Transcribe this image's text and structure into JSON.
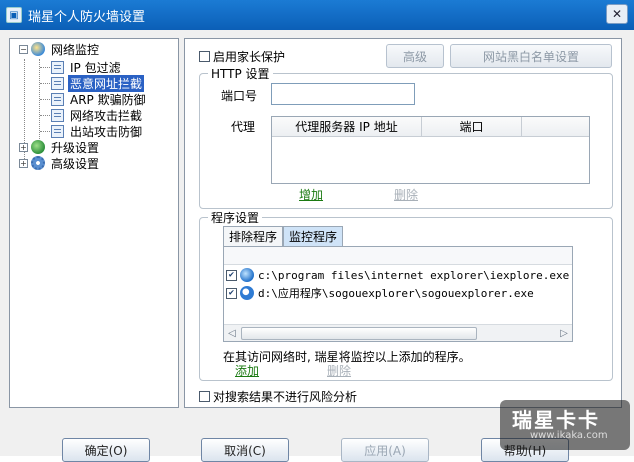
{
  "window": {
    "title": "瑞星个人防火墙设置",
    "close_glyph": "✕"
  },
  "tree": {
    "root": {
      "label": "网络监控",
      "expander": "−",
      "icon": "globe-shield-icon"
    },
    "children": [
      {
        "label": "IP 包过滤",
        "icon": "document-icon"
      },
      {
        "label": "恶意网址拦截",
        "icon": "document-icon",
        "selected": true
      },
      {
        "label": "ARP 欺骗防御",
        "icon": "document-icon"
      },
      {
        "label": "网络攻击拦截",
        "icon": "document-icon"
      },
      {
        "label": "出站攻击防御",
        "icon": "document-icon"
      }
    ],
    "others": [
      {
        "label": "升级设置",
        "expander": "+",
        "icon": "globe-icon"
      },
      {
        "label": "高级设置",
        "expander": "+",
        "icon": "gear-icon"
      }
    ]
  },
  "panel": {
    "parental_label": "启用家长保护",
    "advanced_button": "高级",
    "blacklist_button": "网站黑白名单设置",
    "http": {
      "title": "HTTP 设置",
      "port_label": "端口号",
      "port_value": "",
      "proxy_label": "代理",
      "columns": [
        "代理服务器 IP 地址",
        "端口"
      ],
      "add_link": "增加",
      "delete_link": "删除"
    },
    "program": {
      "title": "程序设置",
      "tabs": [
        "排除程序",
        "监控程序"
      ],
      "active_tab": 1,
      "items": [
        {
          "checked": true,
          "icon": "ie-icon",
          "path": "c:\\program files\\internet explorer\\iexplore.exe"
        },
        {
          "checked": true,
          "icon": "sogou-icon",
          "path": "d:\\应用程序\\sogouexplorer\\sogouexplorer.exe"
        }
      ],
      "hint": "在其访问网络时, 瑞星将监控以上添加的程序。",
      "add_link": "添加",
      "delete_link": "删除"
    },
    "no_risk_label": "对搜索结果不进行风险分析"
  },
  "buttons": {
    "ok": "确定(O)",
    "cancel": "取消(C)",
    "apply": "应用(A)",
    "help": "帮助(H)"
  },
  "watermark": {
    "line1": "瑞星卡卡",
    "line2": "www.ikaka.com"
  },
  "colors": {
    "titlebar": "#1b7bd4",
    "selection": "#2a61c4",
    "link_green": "#1b7a12"
  }
}
